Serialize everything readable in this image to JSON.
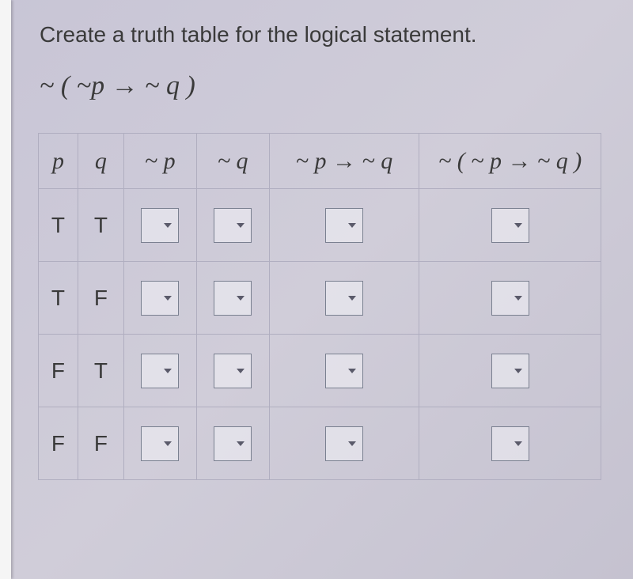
{
  "instruction": "Create a truth table for the logical statement.",
  "formula": "~ ( ~p → ~ q )",
  "headers": {
    "p": "p",
    "q": "q",
    "np": "~ p",
    "nq": "~ q",
    "impl": "~ p → ~ q",
    "neg": "~ ( ~ p → ~ q )"
  },
  "rows": [
    {
      "p": "T",
      "q": "T"
    },
    {
      "p": "T",
      "q": "F"
    },
    {
      "p": "F",
      "q": "T"
    },
    {
      "p": "F",
      "q": "F"
    }
  ]
}
